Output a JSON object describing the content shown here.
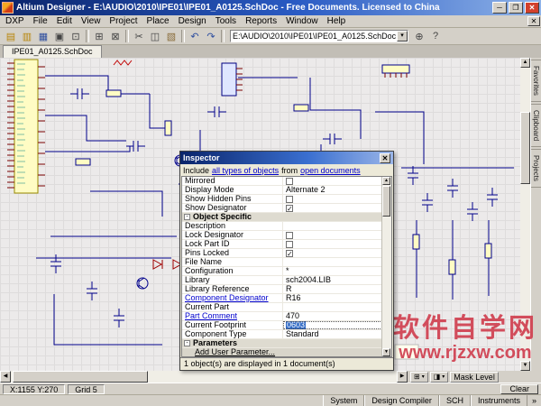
{
  "window": {
    "title": "Altium Designer - E:\\AUDIO\\2010\\IPE01\\IPE01_A0125.SchDoc - Free Documents. Licensed to China",
    "controls": {
      "minimize": "─",
      "maximize": "❐",
      "close": "✕"
    }
  },
  "menu": {
    "items": [
      "DXP",
      "File",
      "Edit",
      "View",
      "Project",
      "Place",
      "Design",
      "Tools",
      "Reports",
      "Window",
      "Help"
    ],
    "close_glyph": "✕"
  },
  "toolbar": {
    "path_value": "E:\\AUDIO\\2010\\IPE01\\IPE01_A0125.SchDoc",
    "combo_arrow": "▾",
    "icons": [
      {
        "name": "open-project-icon",
        "glyph": "▤",
        "color": "#b8860b"
      },
      {
        "name": "open-document-icon",
        "glyph": "▥",
        "color": "#b8860b"
      },
      {
        "name": "save-icon",
        "glyph": "▦",
        "color": "#2f4f9f"
      },
      {
        "name": "print-icon",
        "glyph": "▣",
        "color": "#444444"
      },
      {
        "name": "print-preview-icon",
        "glyph": "⊡",
        "color": "#444444"
      },
      {
        "sep": true
      },
      {
        "name": "zoom-window-icon",
        "glyph": "⊞",
        "color": "#444444"
      },
      {
        "name": "zoom-fit-icon",
        "glyph": "⊠",
        "color": "#444444"
      },
      {
        "sep": true
      },
      {
        "name": "cut-icon",
        "glyph": "✂",
        "color": "#444444"
      },
      {
        "name": "copy-icon",
        "glyph": "◫",
        "color": "#444444"
      },
      {
        "name": "paste-icon",
        "glyph": "▧",
        "color": "#8a6d3b"
      },
      {
        "sep": true
      },
      {
        "name": "undo-icon",
        "glyph": "↶",
        "color": "#2f4f9f"
      },
      {
        "name": "redo-icon",
        "glyph": "↷",
        "color": "#2f4f9f"
      },
      {
        "sep": true
      }
    ],
    "icons_right": [
      {
        "name": "cross-probe-icon",
        "glyph": "⊕",
        "color": "#444444"
      },
      {
        "name": "help-icon",
        "glyph": "?",
        "color": "#444444"
      }
    ]
  },
  "tabs": {
    "active": "IPE01_A0125.SchDoc"
  },
  "side_tabs": [
    "Favorites",
    "Clipboard",
    "Projects"
  ],
  "inspector": {
    "title": "Inspector",
    "include": {
      "prefix": "Include",
      "types_link": "all types of objects",
      "middle": "from",
      "docs_link": "open documents"
    },
    "rows": [
      {
        "label": "Mirrored",
        "type": "checkbox",
        "checked": false
      },
      {
        "label": "Display Mode",
        "type": "text",
        "value": "Alternate 2"
      },
      {
        "label": "Show Hidden Pins",
        "type": "checkbox",
        "checked": false
      },
      {
        "label": "Show Designator",
        "type": "checkbox",
        "checked": true
      },
      {
        "label": "Object Specific",
        "type": "section"
      },
      {
        "label": "Description",
        "type": "text",
        "value": ""
      },
      {
        "label": "Lock Designator",
        "type": "checkbox",
        "checked": false
      },
      {
        "label": "Lock Part ID",
        "type": "checkbox",
        "checked": false
      },
      {
        "label": "Pins Locked",
        "type": "checkbox",
        "checked": true
      },
      {
        "label": "File Name",
        "type": "text",
        "value": ""
      },
      {
        "label": "Configuration",
        "type": "text",
        "value": "*"
      },
      {
        "label": "Library",
        "type": "text",
        "value": "sch2004.LIB"
      },
      {
        "label": "Library Reference",
        "type": "text",
        "value": "R"
      },
      {
        "label": "Component Designator",
        "type": "link",
        "value": "R16"
      },
      {
        "label": "Current Part",
        "type": "text",
        "value": ""
      },
      {
        "label": "Part Comment",
        "type": "link",
        "value": "470"
      },
      {
        "label": "Current Footprint",
        "type": "edit",
        "value": "0603"
      },
      {
        "label": "Component Type",
        "type": "text",
        "value": "Standard"
      },
      {
        "label": "Parameters",
        "type": "section"
      },
      {
        "label": "Add User Parameter...",
        "type": "add"
      }
    ],
    "status": "1 object(s) are displayed in 1 document(s)",
    "close_glyph": "✕",
    "check_glyph": "✓"
  },
  "status_bar": {
    "coords": "X:1155 Y:270",
    "grid": "Grid 5",
    "mask_level": "Mask Level",
    "clear_label": "Clear"
  },
  "panel_bar": {
    "buttons": [
      "System",
      "Design Compiler",
      "SCH",
      "Instruments"
    ],
    "overflow_glyph": "»"
  },
  "watermark": {
    "line1": "软件自学网",
    "line2": "www.rjzxw.com"
  },
  "colors": {
    "titlebar_start": "#0a246a",
    "titlebar_end": "#8fb3e8",
    "chrome": "#d4d0c8",
    "canvas": "#eceaea",
    "selection": "#316ac5",
    "watermark": "#d04050",
    "link": "#0000cc"
  }
}
